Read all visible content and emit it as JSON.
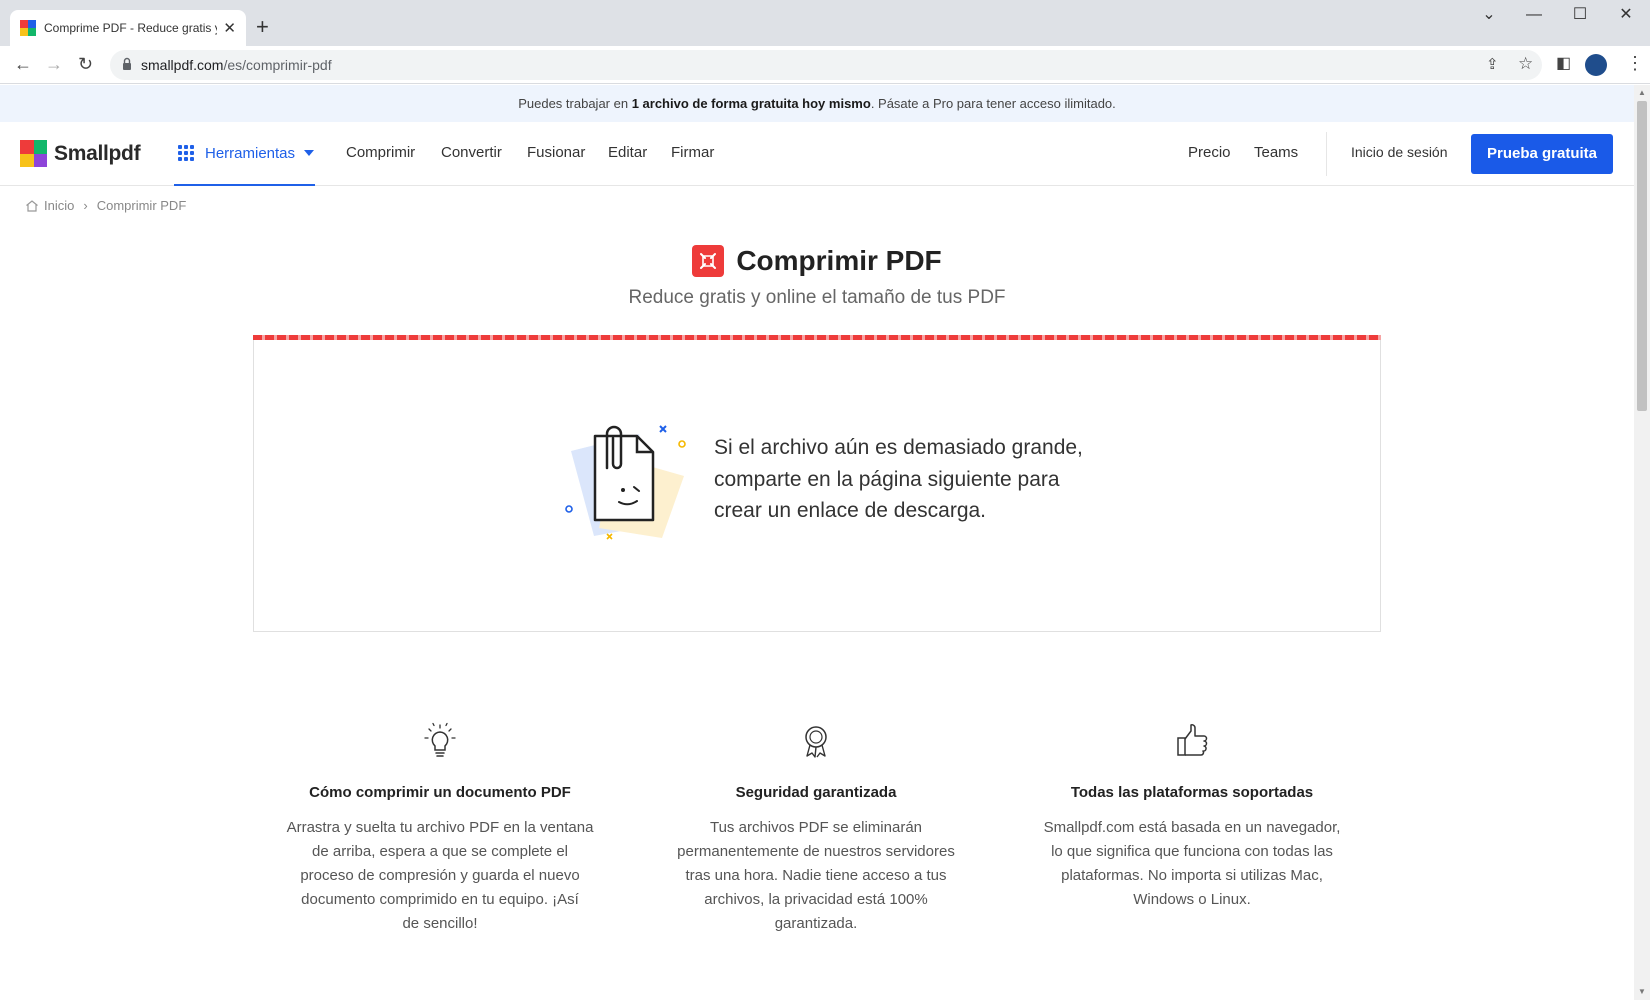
{
  "browser": {
    "tab_title": "Comprime PDF - Reduce gratis y online el tamaño de tus PDF",
    "url_host": "smallpdf.com",
    "url_path": "/es/comprimir-pdf"
  },
  "banner": {
    "prefix": "Puedes trabajar en ",
    "bold": "1 archivo de forma gratuita hoy mismo",
    "suffix": ". Pásate a Pro para tener acceso ilimitado."
  },
  "nav": {
    "logo": "Smallpdf",
    "tools": "Herramientas",
    "links": [
      "Comprimir",
      "Convertir",
      "Fusionar",
      "Editar",
      "Firmar"
    ],
    "right_links": [
      "Precio",
      "Teams"
    ],
    "login": "Inicio de sesión",
    "cta": "Prueba gratuita"
  },
  "breadcrumb": {
    "home": "Inicio",
    "current": "Comprimir PDF"
  },
  "hero": {
    "title": "Comprimir PDF",
    "subtitle": "Reduce gratis y online el tamaño de tus PDF"
  },
  "dropzone": {
    "lines": [
      "Si el archivo aún es demasiado grande,",
      "comparte en la página siguiente para",
      "crear un enlace de descarga."
    ]
  },
  "features": [
    {
      "icon": "lightbulb-icon",
      "title": "Cómo comprimir un documento PDF",
      "lines": [
        "Arrastra y suelta tu archivo PDF en la ventana",
        "de arriba, espera a que se complete el",
        "proceso de compresión y guarda el nuevo",
        "documento comprimido en tu equipo. ¡Así",
        "de sencillo!"
      ]
    },
    {
      "icon": "award-badge-icon",
      "title": "Seguridad garantizada",
      "lines": [
        "Tus archivos PDF se eliminarán",
        "permanentemente de nuestros servidores",
        "tras una hora. Nadie tiene acceso a tus",
        "archivos, la privacidad está 100%",
        "garantizada."
      ]
    },
    {
      "icon": "thumbs-up-icon",
      "title": "Todas las plataformas soportadas",
      "lines": [
        "Smallpdf.com está basada en un navegador,",
        "lo que significa que funciona con todas las",
        "plataformas. No importa si utilizas Mac,",
        "Windows o Linux."
      ]
    }
  ],
  "colors": {
    "brand_blue": "#1a5ae8",
    "tool_red": "#ee3b3a",
    "banner_bg": "#eef4fd"
  }
}
